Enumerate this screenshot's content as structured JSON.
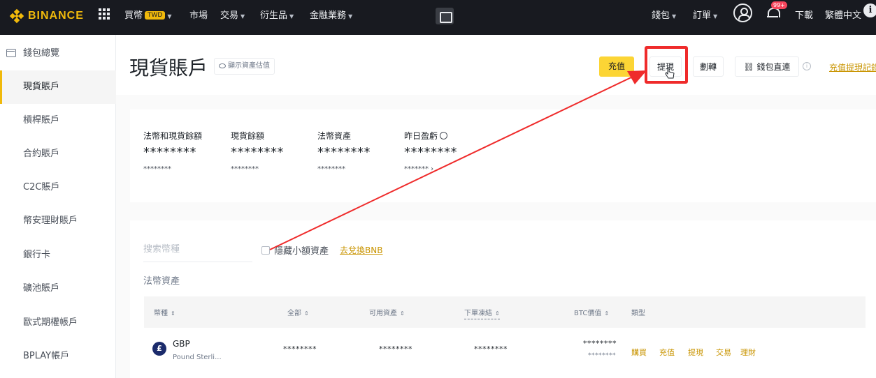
{
  "brand": {
    "name": "BINANCE",
    "color": "#f0b90b"
  },
  "topnav": {
    "items": [
      {
        "label": "買幣",
        "badge": "TWD"
      },
      {
        "label": "市場"
      },
      {
        "label": "交易"
      },
      {
        "label": "衍生品"
      },
      {
        "label": "金融業務"
      }
    ],
    "right": {
      "wallet": "錢包",
      "orders": "訂單",
      "notification_badge": "99+",
      "download": "下載",
      "language": "繁體中文",
      "info": "i"
    }
  },
  "sidebar": {
    "items": [
      {
        "label": "錢包總覽",
        "icon": "wallet-icon"
      },
      {
        "label": "現貨賬戶",
        "active": true
      },
      {
        "label": "槓桿賬戶"
      },
      {
        "label": "合約賬戶"
      },
      {
        "label": "C2C賬戶"
      },
      {
        "label": "幣安理財賬戶"
      },
      {
        "label": "銀行卡"
      },
      {
        "label": "礦池賬戶"
      },
      {
        "label": "歐式期權帳戶"
      },
      {
        "label": "BPLAY帳戶"
      }
    ]
  },
  "header": {
    "title": "現貨賬戶",
    "show_assets": "顯示資產估值",
    "buttons": {
      "deposit": "充值",
      "withdraw": "提現",
      "transfer": "劃轉",
      "wallet_link": "錢包直連"
    },
    "history_link": "充值提現記錄"
  },
  "balances": [
    {
      "label": "法幣和現貨餘額",
      "value": "********",
      "sub": "********"
    },
    {
      "label": "現貨餘額",
      "value": "********",
      "sub": "********"
    },
    {
      "label": "法幣資產",
      "value": "********",
      "sub": "********"
    },
    {
      "label": "昨日盈虧",
      "value": "********",
      "sub": "******* ›"
    }
  ],
  "assets": {
    "search_placeholder": "搜索幣種",
    "hide_small": "隱藏小額資產",
    "convert_bnb": "去兌換BNB",
    "section_label": "法幣資產",
    "columns": [
      "幣種",
      "全部",
      "可用資產",
      "下單凍結",
      "BTC價值",
      "類型"
    ],
    "rows": [
      {
        "code": "GBP",
        "name": "Pound Sterli...",
        "total": "********",
        "available": "********",
        "frozen": "********",
        "btc_value": "********",
        "btc_value_sub": "********",
        "actions": [
          "購買",
          "充值",
          "提現",
          "交易",
          "理財"
        ]
      }
    ]
  },
  "annotation": {
    "highlight_color": "#ef2b2b"
  }
}
